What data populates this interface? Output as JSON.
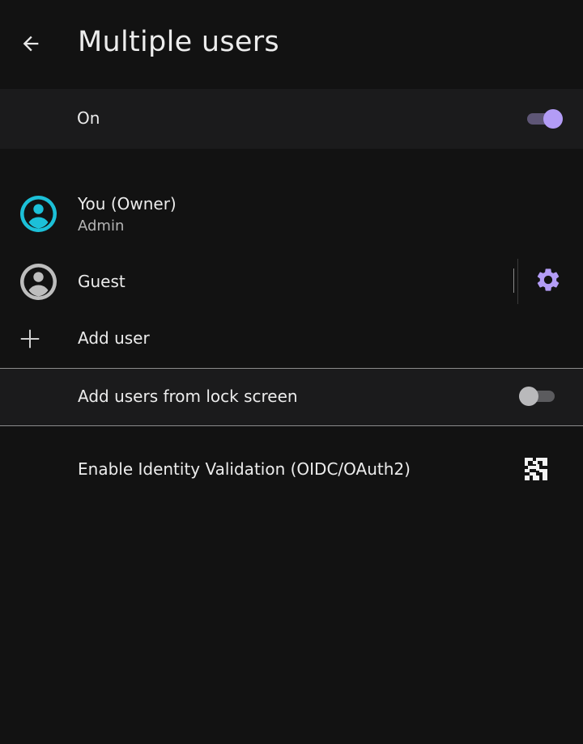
{
  "header": {
    "title": "Multiple users",
    "back_icon": "arrow-left-icon"
  },
  "main_switch": {
    "label": "On",
    "checked": true
  },
  "users": [
    {
      "name": "You (Owner)",
      "role": "Admin",
      "avatar_icon": "account-circle-icon",
      "avatar_color": "#1cc0d8"
    },
    {
      "name": "Guest",
      "avatar_icon": "account-circle-icon",
      "avatar_color": "#bdbdbd",
      "settings_icon": "gear-icon",
      "settings_color": "#b39cf6"
    }
  ],
  "add_user": {
    "label": "Add user",
    "icon": "plus-icon"
  },
  "lock_screen": {
    "label": "Add users from lock screen",
    "checked": false
  },
  "identity": {
    "label": "Enable Identity Validation (OIDC/OAuth2)",
    "icon": "qr-code-icon"
  },
  "colors": {
    "background": "#121212",
    "row_highlight": "#1b1b1c",
    "accent": "#b39cf6",
    "owner_avatar": "#1cc0d8"
  }
}
